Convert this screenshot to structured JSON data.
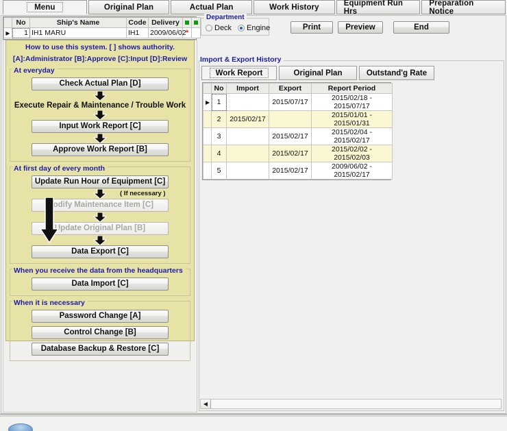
{
  "tabs": [
    {
      "label": "Menu",
      "active": true
    },
    {
      "label": "Original Plan",
      "active": false
    },
    {
      "label": "Actual Plan",
      "active": false
    },
    {
      "label": "Work History",
      "active": false
    },
    {
      "label": "Equipment Run Hrs",
      "active": false
    },
    {
      "label": "Preparation Notice",
      "active": false
    }
  ],
  "ship_grid": {
    "headers": [
      "No",
      "Ship's Name",
      "Code",
      "Delivery"
    ],
    "row": {
      "no": "1",
      "name": "IH1 MARU",
      "code": "IH1",
      "delivery": "2009/06/02",
      "marker": "*"
    }
  },
  "department": {
    "title": "Department",
    "options": [
      {
        "label": "Deck",
        "checked": false
      },
      {
        "label": "Engine",
        "checked": true
      }
    ]
  },
  "top_buttons": {
    "print": "Print",
    "preview": "Preview",
    "end": "End"
  },
  "menu_panel": {
    "howto_line1": "How to use this system.  [ ] shows authority.",
    "howto_line2": "[A]:Administrator  [B]:Approve  [C]:Input  [D]:Review",
    "groups": [
      {
        "title": "At everyday",
        "items": [
          {
            "kind": "button",
            "label": "Check Actual Plan  [D]",
            "enabled": true
          },
          {
            "kind": "arrow"
          },
          {
            "kind": "text",
            "label": "Execute Repair & Maintenance / Trouble Work"
          },
          {
            "kind": "arrow"
          },
          {
            "kind": "button",
            "label": "Input Work Report  [C]",
            "enabled": true
          },
          {
            "kind": "arrow"
          },
          {
            "kind": "button",
            "label": "Approve Work Report  [B]",
            "enabled": true
          }
        ]
      },
      {
        "title": "At first day of every month",
        "items": [
          {
            "kind": "button",
            "label": "Update Run Hour of Equipment  [C]",
            "enabled": true
          },
          {
            "kind": "arrow-ifnec",
            "note": "( If necessary )"
          },
          {
            "kind": "button",
            "label": "Modify Maintenance Item  [C]",
            "enabled": false
          },
          {
            "kind": "arrow"
          },
          {
            "kind": "button",
            "label": "Update Original Plan  [B]",
            "enabled": false
          },
          {
            "kind": "arrow"
          },
          {
            "kind": "button",
            "label": "Data Export  [C]",
            "enabled": true
          }
        ]
      },
      {
        "title": "When you receive the data from the headquarters",
        "items": [
          {
            "kind": "button",
            "label": "Data Import  [C]",
            "enabled": true
          }
        ]
      },
      {
        "title": "When it is necessary",
        "items": [
          {
            "kind": "button",
            "label": "Password Change  [A]",
            "enabled": true
          },
          {
            "kind": "button",
            "label": "Control Change  [B]",
            "enabled": true
          },
          {
            "kind": "button",
            "label": "Database Backup & Restore  [C]",
            "enabled": true
          }
        ]
      }
    ]
  },
  "history": {
    "title": "Import & Export History",
    "tabs": [
      {
        "label": "Work Report",
        "active": true
      },
      {
        "label": "Original Plan",
        "active": false
      },
      {
        "label": "Outstand'g Rate",
        "active": false
      }
    ],
    "headers": [
      "No",
      "Import",
      "Export",
      "Report Period"
    ],
    "rows": [
      {
        "no": "1",
        "import": "",
        "export": "2015/07/17",
        "period": "2015/02/18 - 2015/07/17",
        "highlight": false,
        "current": true
      },
      {
        "no": "2",
        "import": "2015/02/17",
        "export": "",
        "period": "2015/01/01 - 2015/01/31",
        "highlight": true,
        "current": false
      },
      {
        "no": "3",
        "import": "",
        "export": "2015/02/17",
        "period": "2015/02/04 - 2015/02/17",
        "highlight": false,
        "current": false
      },
      {
        "no": "4",
        "import": "",
        "export": "2015/02/17",
        "period": "2015/02/02 - 2015/02/03",
        "highlight": true,
        "current": false
      },
      {
        "no": "5",
        "import": "",
        "export": "2015/02/17",
        "period": "2009/06/02 - 2015/02/17",
        "highlight": false,
        "current": false
      }
    ]
  },
  "colors": {
    "menu_panel_bg": "#e7e3a7",
    "heading_blue": "#1c1ca8",
    "row_highlight": "#faf7d2",
    "marker_green": "#0a9d0a",
    "asterisk_red": "#e02020",
    "radio_dot": "#1d5fc4"
  }
}
